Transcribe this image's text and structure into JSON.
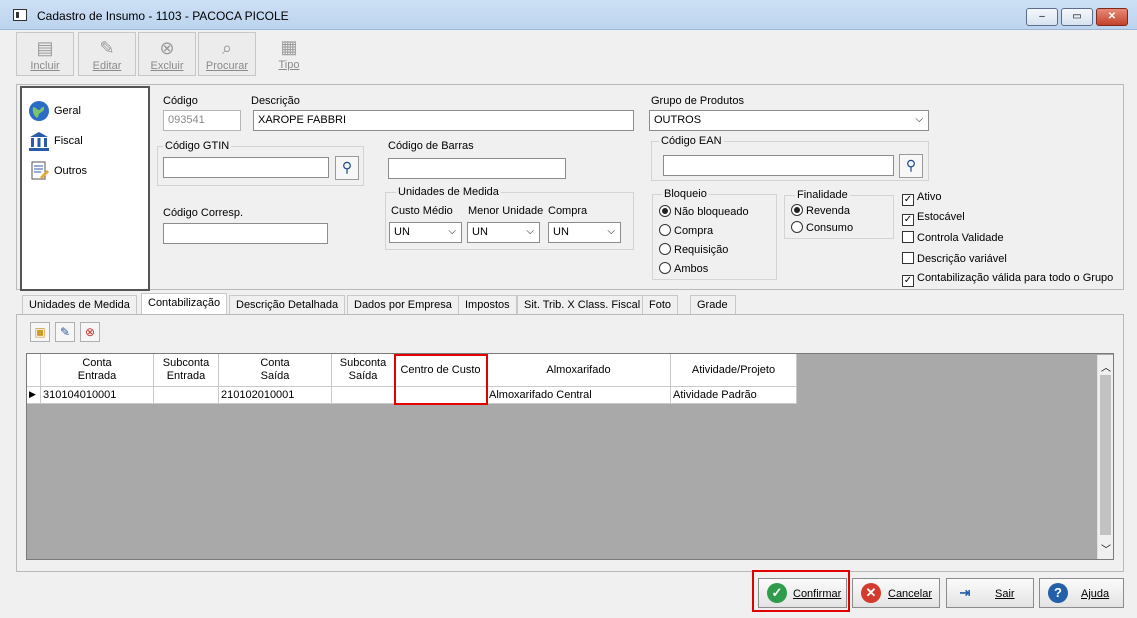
{
  "window": {
    "title": "Cadastro de Insumo - 1103   - PACOCA PICOLE",
    "minimize": "‒",
    "maximize": "▭",
    "close": "✕"
  },
  "toolbar": {
    "incluir": "Incluir",
    "editar": "Editar",
    "excluir": "Excluir",
    "procurar": "Procurar",
    "tipo": "Tipo"
  },
  "nav": {
    "items": [
      {
        "label": "Geral",
        "icon": "globe-icon"
      },
      {
        "label": "Fiscal",
        "icon": "bank-icon"
      },
      {
        "label": "Outros",
        "icon": "document-icon"
      }
    ]
  },
  "form": {
    "codigo_label": "Código",
    "codigo_value": "093541",
    "descricao_label": "Descrição",
    "descricao_value": "XAROPE FABBRI",
    "grupo_label": "Grupo de Produtos",
    "grupo_value": "OUTROS",
    "gtin_label": "Código GTIN",
    "gtin_value": "",
    "barras_label": "Código de Barras",
    "barras_value": "",
    "ean_label": "Código EAN",
    "ean_value": "",
    "corresp_label": "Código Corresp.",
    "corresp_value": "",
    "unidades_title": "Unidades de Medida",
    "custo_label": "Custo Médio",
    "custo_value": "UN",
    "menor_label": "Menor Unidade",
    "menor_value": "UN",
    "compra_label": "Compra",
    "compra_value": "UN",
    "bloqueio_title": "Bloqueio",
    "bloqueio_options": [
      "Não bloqueado",
      "Compra",
      "Requisição",
      "Ambos"
    ],
    "bloqueio_selected": 0,
    "finalidade_title": "Finalidade",
    "finalidade_options": [
      "Revenda",
      "Consumo"
    ],
    "finalidade_selected": 0,
    "checks": [
      {
        "label": "Ativo",
        "checked": true
      },
      {
        "label": "Estocável",
        "checked": true
      },
      {
        "label": "Controla Validade",
        "checked": false
      },
      {
        "label": "Descrição variável",
        "checked": false
      },
      {
        "label": "Contabilização válida para todo o Grupo",
        "checked": true
      }
    ]
  },
  "tabs": [
    "Unidades de Medida",
    "Contabilização",
    "Descrição Detalhada",
    "Dados por Empresa",
    "Impostos",
    "Sit. Trib. X Class. Fiscal",
    "Foto",
    "Grade"
  ],
  "active_tab": 1,
  "grid": {
    "headers": [
      [
        "Conta",
        "Entrada"
      ],
      [
        "Subconta",
        "Entrada"
      ],
      [
        "Conta",
        "Saída"
      ],
      [
        "Subconta",
        "Saída"
      ],
      [
        "Centro de Custo",
        ""
      ],
      [
        "Almoxarifado",
        ""
      ],
      [
        "Atividade/Projeto",
        ""
      ]
    ],
    "rows": [
      [
        "310104010001",
        "",
        "210102010001",
        "",
        "",
        "Almoxarifado Central",
        "Atividade Padrão"
      ]
    ],
    "row_indicator": "▶"
  },
  "buttons": {
    "confirmar": "Confirmar",
    "cancelar": "Cancelar",
    "sair": "Sair",
    "ajuda": "Ajuda"
  },
  "colors": {
    "highlight": "#e00000",
    "confirm_icon": "#2e9c4a",
    "cancel_icon": "#d43b2f",
    "help_icon": "#2460a8"
  }
}
